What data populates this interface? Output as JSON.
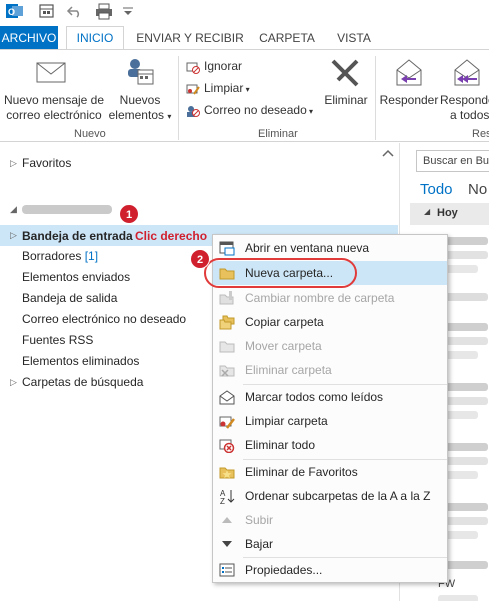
{
  "tabs": {
    "file": "ARCHIVO",
    "home": "INICIO",
    "send_receive": "ENVIAR Y RECIBIR",
    "folder": "CARPETA",
    "view": "VISTA"
  },
  "ribbon": {
    "new_email": [
      "Nuevo mensaje de",
      "correo electrónico"
    ],
    "new_items": [
      "Nuevos",
      "elementos"
    ],
    "group_new": "Nuevo",
    "ignore": "Ignorar",
    "clean_up": "Limpiar",
    "junk": "Correo no deseado",
    "delete": "Eliminar",
    "group_delete": "Eliminar",
    "reply": "Responder",
    "reply_all": [
      "Responder",
      "a todos"
    ],
    "group_respond": "Res"
  },
  "folders": {
    "favorites": "Favoritos",
    "inbox": "Bandeja de entrada",
    "drafts": "Borradores",
    "drafts_count": "[1]",
    "sent": "Elementos enviados",
    "outbox": "Bandeja de salida",
    "junk": "Correo electrónico no deseado",
    "rss": "Fuentes RSS",
    "deleted": "Elementos eliminados",
    "search_folders": "Carpetas de búsqueda"
  },
  "annotations": {
    "step1": "1",
    "step2": "2",
    "right_click": "Clic derecho"
  },
  "mail_list": {
    "search_placeholder": "Buscar en Buz",
    "filter_all": "Todo",
    "filter_unread": "No",
    "group_today": "Hoy",
    "fw_label": "FW"
  },
  "context_menu": [
    {
      "label": "Abrir en ventana nueva",
      "icon": "open-window-icon",
      "disabled": false
    },
    {
      "label": "Nueva carpeta...",
      "icon": "folder-icon",
      "disabled": false
    },
    {
      "label": "Cambiar nombre de carpeta",
      "icon": "rename-icon",
      "disabled": true
    },
    {
      "label": "Copiar carpeta",
      "icon": "copy-folder-icon",
      "disabled": false
    },
    {
      "label": "Mover carpeta",
      "icon": "move-folder-icon",
      "disabled": true
    },
    {
      "label": "Eliminar carpeta",
      "icon": "delete-folder-icon",
      "disabled": true
    },
    {
      "label": "Marcar todos como leídos",
      "icon": "envelope-open-icon",
      "disabled": false
    },
    {
      "label": "Limpiar carpeta",
      "icon": "cleanup-icon",
      "disabled": false
    },
    {
      "label": "Eliminar todo",
      "icon": "delete-all-icon",
      "disabled": false
    },
    {
      "label": "Eliminar de Favoritos",
      "icon": "star-icon",
      "disabled": false
    },
    {
      "label": "Ordenar subcarpetas de la A a la Z",
      "icon": "sort-az-icon",
      "disabled": false
    },
    {
      "label": "Subir",
      "icon": "up-arrow-icon",
      "disabled": true
    },
    {
      "label": "Bajar",
      "icon": "down-arrow-icon",
      "disabled": false
    },
    {
      "label": "Propiedades...",
      "icon": "properties-icon",
      "disabled": false
    }
  ],
  "colors": {
    "accent": "#0072c6",
    "selection": "#cde6f7",
    "annotation_red": "#d0202e"
  }
}
